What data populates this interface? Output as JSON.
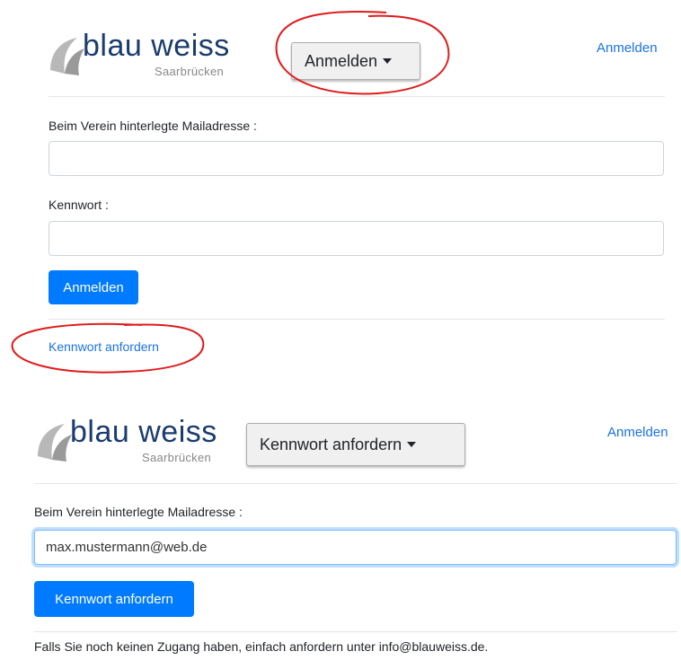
{
  "login_panel": {
    "logo": {
      "title": "blau weiss",
      "subtitle": "Saarbrücken",
      "icon": "club-logo-icon"
    },
    "dropdown_label": "Anmelden",
    "nav_link": "Anmelden",
    "email_label": "Beim Verein hinterlegte Mailadresse :",
    "email_value": "",
    "password_label": "Kennwort :",
    "password_value": "",
    "submit_label": "Anmelden",
    "request_link": "Kennwort anfordern"
  },
  "request_panel": {
    "logo": {
      "title": "blau weiss",
      "subtitle": "Saarbrücken",
      "icon": "club-logo-icon"
    },
    "dropdown_label": "Kennwort anfordern",
    "nav_link": "Anmelden",
    "email_label": "Beim Verein hinterlegte Mailadresse :",
    "email_value": "max.mustermann@web.de",
    "submit_label": "Kennwort anfordern",
    "footer": "Falls Sie noch keinen Zugang haben, einfach anfordern unter info@blauweiss.de."
  },
  "colors": {
    "primary": "#007bff",
    "link": "#1a73e8",
    "annotation": "#e01b1b",
    "logo_text": "#1a3c6e"
  }
}
